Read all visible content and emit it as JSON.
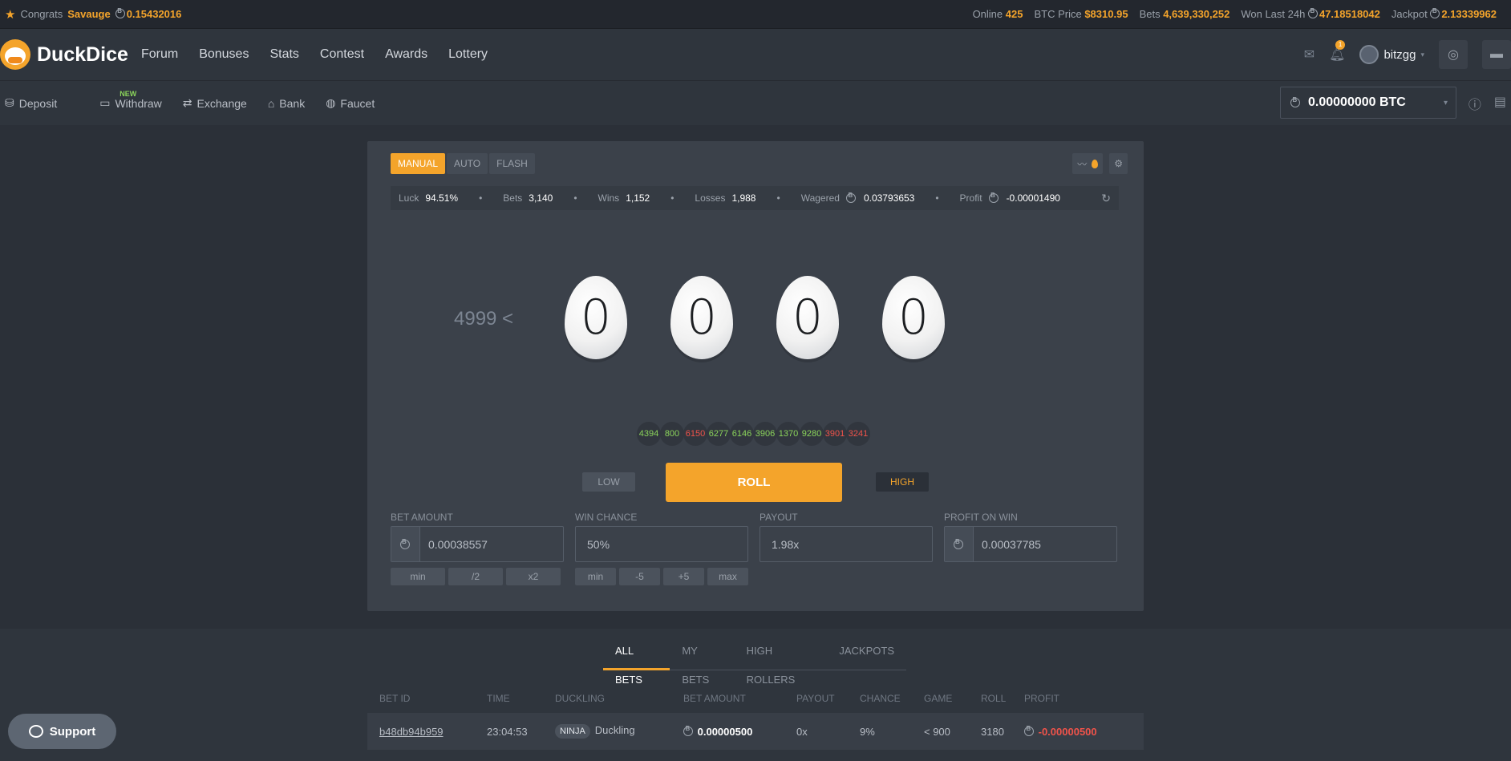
{
  "topbar": {
    "congrats_label": "Congrats",
    "congrats_user": "Savauge",
    "congrats_amount": "0.15432016",
    "online_label": "Online",
    "online_value": "425",
    "btc_price_label": "BTC Price",
    "btc_price_value": "$8310.95",
    "bets_label": "Bets",
    "bets_value": "4,639,330,252",
    "won_label": "Won Last 24h",
    "won_value": "47.18518042",
    "jackpot_label": "Jackpot",
    "jackpot_value": "2.13339962"
  },
  "nav": {
    "brand": "DuckDice",
    "links": [
      "Forum",
      "Bonuses",
      "Stats",
      "Contest",
      "Awards",
      "Lottery"
    ],
    "notification_count": "1",
    "username": "bitzgg"
  },
  "subnav": {
    "links": [
      "Deposit",
      "Withdraw",
      "Exchange",
      "Bank",
      "Faucet"
    ],
    "new_tag": "NEW",
    "balance": "0.00000000 BTC"
  },
  "game": {
    "tabs": [
      "MANUAL",
      "AUTO",
      "FLASH"
    ],
    "stats": [
      {
        "label": "Luck",
        "value": "94.51%"
      },
      {
        "label": "Bets",
        "value": "3,140"
      },
      {
        "label": "Wins",
        "value": "1,152"
      },
      {
        "label": "Losses",
        "value": "1,988"
      },
      {
        "label": "Wagered",
        "value": "0.03793653"
      },
      {
        "label": "Profit",
        "value": "-0.00001490"
      }
    ],
    "target": "4999 <",
    "digits": [
      "0",
      "0",
      "0",
      "0"
    ],
    "history": [
      {
        "value": "4394",
        "result": "win"
      },
      {
        "value": "800",
        "result": "win"
      },
      {
        "value": "6150",
        "result": "lose"
      },
      {
        "value": "6277",
        "result": "win"
      },
      {
        "value": "6146",
        "result": "win"
      },
      {
        "value": "3906",
        "result": "win"
      },
      {
        "value": "1370",
        "result": "win"
      },
      {
        "value": "9280",
        "result": "win"
      },
      {
        "value": "3901",
        "result": "lose"
      },
      {
        "value": "3241",
        "result": "lose"
      }
    ],
    "low_label": "LOW",
    "roll_label": "ROLL",
    "high_label": "HIGH",
    "fields": {
      "bet_amount_label": "BET AMOUNT",
      "bet_amount_value": "0.00038557",
      "win_chance_label": "WIN CHANCE",
      "win_chance_value": "50%",
      "payout_label": "PAYOUT",
      "payout_value": "1.98x",
      "profit_label": "PROFIT ON WIN",
      "profit_value": "0.00037785"
    },
    "bet_quick": [
      "min",
      "/2",
      "x2"
    ],
    "chance_quick": [
      "min",
      "-5",
      "+5",
      "max"
    ]
  },
  "bets": {
    "tabs": [
      "ALL BETS",
      "MY BETS",
      "HIGH ROLLERS",
      "JACKPOTS"
    ],
    "columns": [
      "BET ID",
      "TIME",
      "DUCKLING",
      "BET AMOUNT",
      "PAYOUT",
      "CHANCE",
      "GAME",
      "ROLL",
      "PROFIT"
    ],
    "rows": [
      {
        "id": "b48db94b959",
        "time": "23:04:53",
        "badge": "NINJA",
        "user": "Duckling",
        "amount": "0.00000500",
        "payout": "0x",
        "chance": "9%",
        "game": "< 900",
        "roll": "3180",
        "profit": "-0.00000500"
      }
    ]
  },
  "support_label": "Support",
  "colors": {
    "accent": "#f4a42b",
    "win": "#8bd45b",
    "lose": "#f0534a",
    "background": "#2b3038",
    "panel": "#3b414a"
  }
}
